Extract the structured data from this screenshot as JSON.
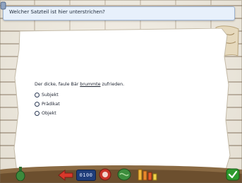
{
  "header": {
    "question_prompt": "Welcher Satzteil ist hier unterstrichen?"
  },
  "exercise": {
    "sentence_before": "Der dicke, faule Bär ",
    "sentence_underlined": "brummte",
    "sentence_after": " zufrieden.",
    "options": [
      {
        "label": "Subjekt",
        "selected": false
      },
      {
        "label": "Prädikat",
        "selected": false
      },
      {
        "label": "Objekt",
        "selected": false
      }
    ]
  },
  "toolbar": {
    "counter_display": "0100",
    "icons": [
      "bottle-icon",
      "arrow-left-icon",
      "counter-display",
      "red-circle-icon",
      "green-globe-icon",
      "folder-icon",
      "checkmark-icon"
    ]
  },
  "colors": {
    "header_bg": "#e7f0fb",
    "header_border": "#9fb6d6",
    "sheet": "#ffffff",
    "text": "#1d2330",
    "check_green": "#2e9a2e"
  }
}
